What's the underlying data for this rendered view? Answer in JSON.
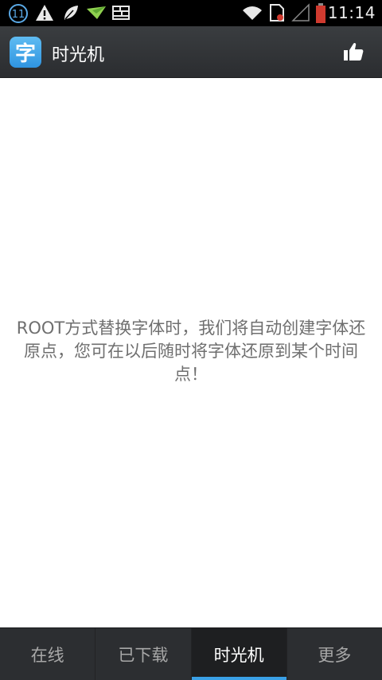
{
  "status_bar": {
    "notification_count": "11",
    "time": "11:14",
    "icons": [
      "notification-count-icon",
      "warning-icon",
      "leaf-icon",
      "paper-plane-icon",
      "grid-icon",
      "wifi-icon",
      "sim-card-icon",
      "signal-icon",
      "battery-icon"
    ],
    "battery_color": "#d03a2f"
  },
  "action_bar": {
    "app_icon_glyph": "字",
    "title": "时光机",
    "accent": "#3aa0e6"
  },
  "main": {
    "message": "ROOT方式替换字体时，我们将自动创建字体还原点，您可在以后随时将字体还原到某个时间点！"
  },
  "tabs": [
    {
      "label": "在线",
      "active": false
    },
    {
      "label": "已下载",
      "active": false
    },
    {
      "label": "时光机",
      "active": true
    },
    {
      "label": "更多",
      "active": false
    }
  ]
}
